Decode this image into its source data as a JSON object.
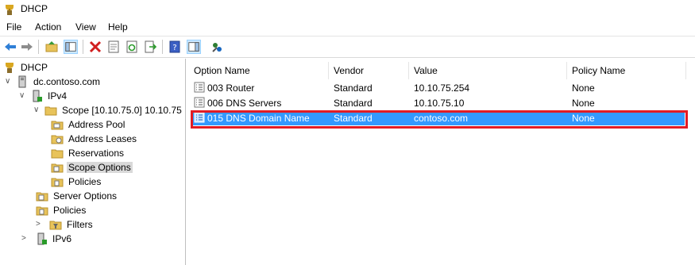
{
  "window": {
    "title": "DHCP"
  },
  "menu": [
    {
      "label": "File"
    },
    {
      "label": "Action"
    },
    {
      "label": "View"
    },
    {
      "label": "Help"
    }
  ],
  "toolbar": {
    "buttons": [
      "back-icon",
      "forward-icon",
      "up-folder-icon",
      "show-hide-tree-icon",
      "delete-icon",
      "properties-icon",
      "refresh-icon",
      "export-list-icon",
      "help-icon",
      "show-action-pane-icon",
      "configure-options-icon"
    ]
  },
  "tree": {
    "root": "DHCP",
    "server": "dc.contoso.com",
    "ipv4": "IPv4",
    "scope": "Scope [10.10.75.0] 10.10.75",
    "address_pool": "Address Pool",
    "address_leases": "Address Leases",
    "reservations": "Reservations",
    "scope_options": "Scope Options",
    "scope_policies": "Policies",
    "server_options": "Server Options",
    "policies": "Policies",
    "filters": "Filters",
    "ipv6": "IPv6"
  },
  "list": {
    "columns": [
      "Option Name",
      "Vendor",
      "Value",
      "Policy Name"
    ],
    "rows": [
      {
        "option": "003 Router",
        "vendor": "Standard",
        "value": "10.10.75.254",
        "policy": "None"
      },
      {
        "option": "006 DNS Servers",
        "vendor": "Standard",
        "value": "10.10.75.10",
        "policy": "None"
      },
      {
        "option": "015 DNS Domain Name",
        "vendor": "Standard",
        "value": "contoso.com",
        "policy": "None"
      }
    ]
  },
  "colors": {
    "selection": "#3399ff",
    "highlight_border": "#e21c25"
  }
}
